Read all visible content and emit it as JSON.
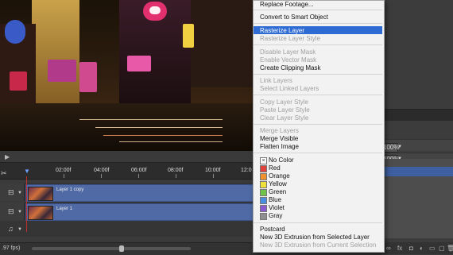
{
  "context_menu": {
    "top_item": "Replace Footage...",
    "smart_object": "Convert to Smart Object",
    "rasterize_layer": "Rasterize Layer",
    "rasterize_layer_style": "Rasterize Layer Style",
    "disable_layer_mask": "Disable Layer Mask",
    "enable_vector_mask": "Enable Vector Mask",
    "create_clipping_mask": "Create Clipping Mask",
    "link_layers": "Link Layers",
    "select_linked_layers": "Select Linked Layers",
    "copy_layer_style": "Copy Layer Style",
    "paste_layer_style": "Paste Layer Style",
    "clear_layer_style": "Clear Layer Style",
    "merge_layers": "Merge Layers",
    "merge_visible": "Merge Visible",
    "flatten_image": "Flatten Image",
    "no_color": "No Color",
    "colors": [
      {
        "label": "Red",
        "color": "#e0413b"
      },
      {
        "label": "Orange",
        "color": "#f0902f"
      },
      {
        "label": "Yellow",
        "color": "#efe13a"
      },
      {
        "label": "Green",
        "color": "#6fc24a"
      },
      {
        "label": "Blue",
        "color": "#4a8ee0"
      },
      {
        "label": "Violet",
        "color": "#8a5ad0"
      },
      {
        "label": "Gray",
        "color": "#8f8f8f"
      }
    ],
    "postcard": "Postcard",
    "extrusion_selected": "New 3D Extrusion from Selected Layer",
    "extrusion_current": "New 3D Extrusion from Current Selection"
  },
  "timeline": {
    "ticks": [
      "02:00f",
      "04:00f",
      "06:00f",
      "08:00f",
      "10:00f",
      "12:0"
    ],
    "tracks": [
      {
        "label": "Layer 1 copy"
      },
      {
        "label": "Layer 1"
      }
    ],
    "fps": ".97 fps)"
  },
  "right_panel": {
    "opacity_value": "100%",
    "fill_value": "100%"
  },
  "icons": {
    "play": "play-icon",
    "scissors": "scissors-icon",
    "film": "film-icon",
    "music": "music-note-icon",
    "playhead": "playhead-icon"
  },
  "colors": {
    "menu_highlight": "#2e6bd3",
    "track": "#4f6aa5",
    "playhead": "#c03030"
  }
}
